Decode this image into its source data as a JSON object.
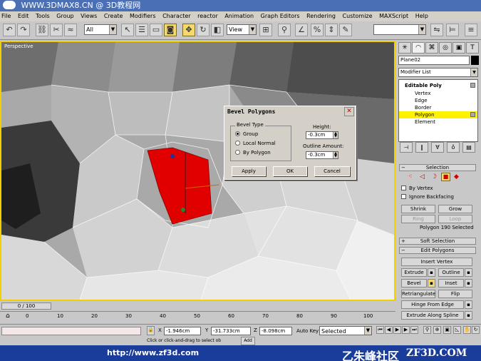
{
  "window": {
    "title": "WWW.3DMAX8.CN @ 3D教程网"
  },
  "menu": [
    "File",
    "Edit",
    "Tools",
    "Group",
    "Views",
    "Create",
    "Modifiers",
    "Character",
    "reactor",
    "Animation",
    "Graph Editors",
    "Rendering",
    "Customize",
    "MAXScript",
    "Help"
  ],
  "toolbar": {
    "selection_filter": "All",
    "ref_coord": "View",
    "named_selection": "",
    "icons": [
      "undo-icon",
      "redo-icon",
      "select-link-icon",
      "unlink-icon",
      "bind-space-warp-icon",
      "select-object-icon",
      "select-by-name-icon",
      "rect-selection-icon",
      "window-crossing-icon",
      "move-icon",
      "rotate-icon",
      "scale-icon",
      "pivot-icon",
      "mirror-icon",
      "align-icon",
      "snap-icon",
      "angle-snap-icon",
      "percent-snap-icon",
      "spinner-snap-icon",
      "edit-named-selection-icon",
      "layer-manager-icon",
      "curve-editor-icon"
    ]
  },
  "viewport": {
    "label": "Perspective"
  },
  "dialog": {
    "title": "Bevel Polygons",
    "group_label": "Bevel Type",
    "options": [
      "Group",
      "Local Normal",
      "By Polygon"
    ],
    "selected": "Group",
    "height_label": "Height:",
    "height_value": "-0.3cm",
    "outline_label": "Outline Amount:",
    "outline_value": "-0.3cm",
    "apply": "Apply",
    "ok": "OK",
    "cancel": "Cancel"
  },
  "command_panel": {
    "object_name": "Plane02",
    "object_color": "#000000",
    "modifier_list": "Modifier List",
    "stack": [
      {
        "label": "Editable Poly",
        "level": 0
      },
      {
        "label": "Vertex",
        "level": 1
      },
      {
        "label": "Edge",
        "level": 1
      },
      {
        "label": "Border",
        "level": 1
      },
      {
        "label": "Polygon",
        "level": 1,
        "selected": true
      },
      {
        "label": "Element",
        "level": 1
      }
    ],
    "selection_rollout": "Selection",
    "by_vertex": "By Vertex",
    "ignore_backfacing": "Ignore Backfacing",
    "shrink": "Shrink",
    "grow": "Grow",
    "ring": "Ring",
    "loop": "Loop",
    "selection_info": "Polygon 190 Selected",
    "soft_selection": "Soft Selection",
    "edit_polygons": "Edit Polygons",
    "insert_vertex": "Insert Vertex",
    "extrude": "Extrude",
    "outline": "Outline",
    "bevel": "Bevel",
    "inset": "Inset",
    "retriangulate": "Retriangulate",
    "flip": "Flip",
    "hinge_from_edge": "Hinge From Edge",
    "extrude_along_spline": "Extrude Along Spline"
  },
  "timeline": {
    "slider": "0 / 100",
    "ticks": [
      "0",
      "10",
      "20",
      "30",
      "40",
      "50",
      "60",
      "70",
      "80",
      "90",
      "100"
    ]
  },
  "status": {
    "x_label": "X",
    "x_value": "-1.946cm",
    "y_label": "Y",
    "y_value": "-31.733cm",
    "z_label": "Z",
    "z_value": "-8.098cm",
    "autokey": "Auto Key",
    "selected": "Selected",
    "prompt": "Click or click-and-drag to select ob",
    "add_time": "Add"
  },
  "footer": {
    "url": "http://www.zf3d.com",
    "brand_cn": "乙朱峰社区",
    "brand_site": "ZF3D.COM"
  }
}
